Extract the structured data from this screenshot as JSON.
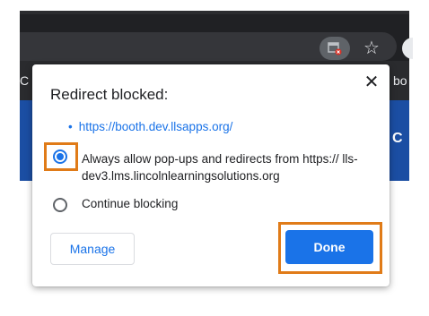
{
  "browser": {
    "bookmarks_left_fragment": "C",
    "bookmarks_right_fragment": "bo",
    "banner_right_fragment": "C",
    "blocked_icon": "popup-blocked-icon",
    "star_icon": "star-icon"
  },
  "dialog": {
    "title": "Redirect blocked:",
    "close_label": "✕",
    "blocked_url": "https://booth.dev.llsapps.org/",
    "options": [
      {
        "label": "Always allow pop-ups and redirects from https:// lls-dev3.lms.lincolnlearningsolutions.org",
        "selected": true
      },
      {
        "label": "Continue blocking",
        "selected": false
      }
    ],
    "manage_label": "Manage",
    "done_label": "Done"
  },
  "colors": {
    "accent": "#1a73e8",
    "highlight": "#e07b18",
    "banner": "#1b4ea3",
    "chrome_dark": "#202124"
  }
}
